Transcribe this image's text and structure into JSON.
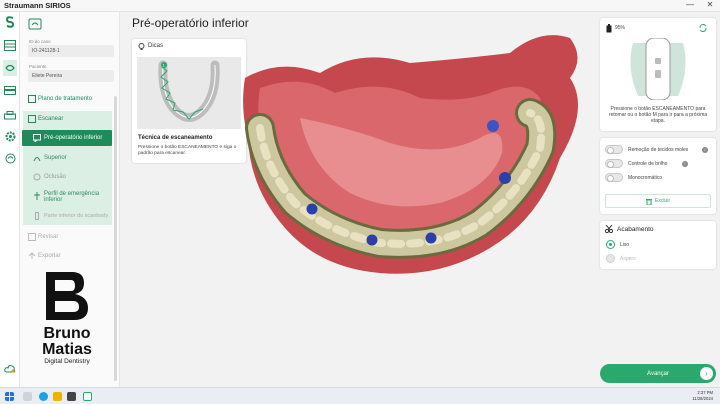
{
  "window": {
    "title": "Straumann SIRIOS",
    "minimize": "—",
    "close": "✕"
  },
  "sidebar": {
    "id_label": "ID do caso",
    "id_value": "IO-241128-1",
    "patient_label": "Paciente",
    "patient_value": "Eliete Pereira",
    "nav": {
      "treatment_plan": "Plano de tratamento",
      "scan": "Escanear",
      "preop_lower": "Pré-operatório inferior",
      "upper": "Superior",
      "occlusion": "Oclusão",
      "emergence_profile": "Perfil de emergência inferior",
      "lower_part_scanbody": "Parte inferior do scanbody",
      "review": "Revisar",
      "export": "Exportar"
    }
  },
  "logo": {
    "line1": "Bruno",
    "line2": "Matias",
    "subtitle": "Digital Dentistry"
  },
  "main": {
    "title": "Pré-operatório inferior"
  },
  "tips": {
    "header": "Dicas",
    "title": "Técnica de escaneamento",
    "text": "Pressione o botão ESCANEAMENTO e siga o padrão para escanear."
  },
  "right_panel": {
    "battery": "95%",
    "scanner_hint": "Pressione o botão ESCANEAMENTO para retomar ou o botão M para ir para a próxima etapa.",
    "options": [
      {
        "label": "Remoção de tecidos moles",
        "on": false,
        "info": true
      },
      {
        "label": "Controle de brilho",
        "on": false,
        "info": true
      },
      {
        "label": "Monocromático",
        "on": false,
        "info": false
      }
    ],
    "delete_label": "Excluir",
    "finish": {
      "header": "Acabamento",
      "options": [
        {
          "label": "Liso",
          "selected": true
        },
        {
          "label": "Áspero",
          "selected": false
        }
      ]
    }
  },
  "next_button": "Avançar",
  "taskbar": {
    "time": "2:37 PM",
    "date": "11/28/2024"
  },
  "colors": {
    "accent": "#1f8a5a",
    "accent_light": "#2aa96e",
    "nav_bg": "#dcefe4"
  }
}
